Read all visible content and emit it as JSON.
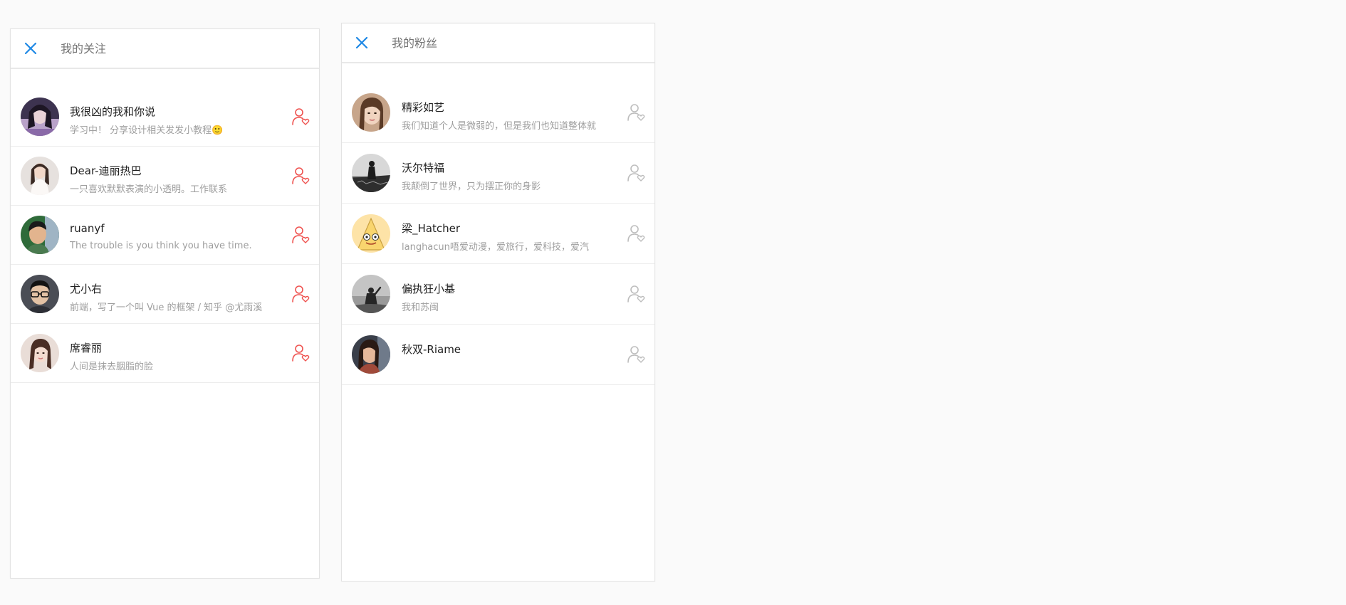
{
  "panels": {
    "following": {
      "title": "我的关注",
      "items": [
        {
          "name": "我很凶的我和你说",
          "desc": "学习中！ 分享设计相关发发小教程🙂"
        },
        {
          "name": "Dear-迪丽热巴",
          "desc": "一只喜欢默默表演的小透明。工作联系"
        },
        {
          "name": "ruanyf",
          "desc": "The trouble is you think you have time."
        },
        {
          "name": "尤小右",
          "desc": "前端，写了一个叫 Vue 的框架 / 知乎 @尤雨溪"
        },
        {
          "name": "席睿丽",
          "desc": "人间是抹去胭脂的脸"
        }
      ]
    },
    "fans": {
      "title": "我的粉丝",
      "items": [
        {
          "name": "精彩如艺",
          "desc": "我们知道个人是微弱的，但是我们也知道整体就"
        },
        {
          "name": "沃尔特福",
          "desc": "我颠倒了世界，只为摆正你的身影"
        },
        {
          "name": "梁_Hatcher",
          "desc": "langhacun唔爱动漫，爱旅行，爱科技，爱汽"
        },
        {
          "name": "偏执狂小基",
          "desc": "我和苏闽"
        },
        {
          "name": "秋双-Riame",
          "desc": ""
        }
      ]
    }
  },
  "icons": {
    "close": "close-icon",
    "follow": "user-heart-icon"
  },
  "colors": {
    "accent_blue": "#1e88e5",
    "follow_active": "#ef5350",
    "follow_inactive": "#bdbdbd",
    "background": "#fafafa"
  }
}
